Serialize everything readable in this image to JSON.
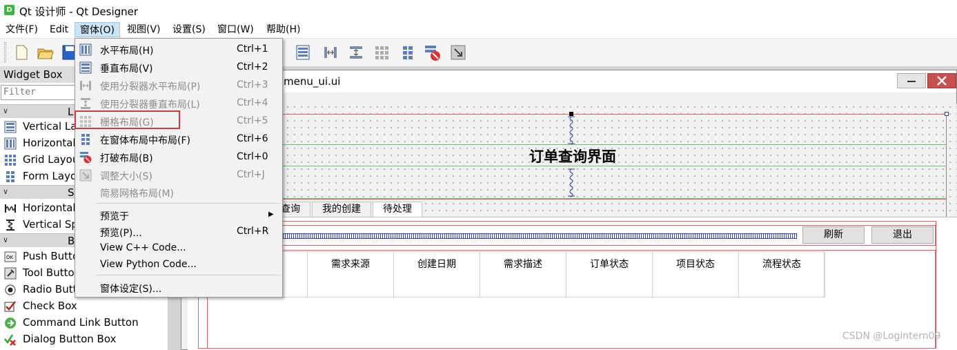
{
  "window": {
    "title": "Qt 设计师 - Qt Designer",
    "app_icon_letter": "D"
  },
  "menubar": [
    "文件(F)",
    "Edit",
    "窗体(O)",
    "视图(V)",
    "设置(S)",
    "窗口(W)",
    "帮助(H)"
  ],
  "widget_box": {
    "title": "Widget Box",
    "filter_placeholder": "Filter",
    "categories": [
      "L",
      "S",
      "B"
    ],
    "layouts": [
      "Vertical La",
      "Horizontal",
      "Grid Layou",
      "Form Layo"
    ],
    "spacers": [
      "Horizontal",
      "Vertical Sp"
    ],
    "buttons": [
      "Push Butto",
      "Tool Butto",
      "Radio Butt",
      "Check Box",
      "Command Link Button",
      "Dialog Button Box"
    ]
  },
  "form_window": {
    "title": "menu_ui.ui",
    "heading": "订单查询界面",
    "tabs": [
      "查询",
      "我的创建",
      "待处理"
    ],
    "refresh_button": "刷新",
    "exit_button": "退出",
    "table_headers": [
      "需求来源",
      "创建日期",
      "需求描述",
      "订单状态",
      "项目状态",
      "流程状态"
    ]
  },
  "form_menu": {
    "items": [
      {
        "label": "水平布局(H)",
        "shortcut": "Ctrl+1",
        "icon": "horizontal-layout-icon",
        "enabled": true
      },
      {
        "label": "垂直布局(V)",
        "shortcut": "Ctrl+2",
        "icon": "vertical-layout-icon",
        "enabled": true
      },
      {
        "label": "使用分裂器水平布局(P)",
        "shortcut": "Ctrl+3",
        "icon": "horizontal-splitter-icon",
        "enabled": false
      },
      {
        "label": "使用分裂器垂直布局(L)",
        "shortcut": "Ctrl+4",
        "icon": "vertical-splitter-icon",
        "enabled": false
      },
      {
        "label": "栅格布局(G)",
        "shortcut": "Ctrl+5",
        "icon": "grid-layout-icon",
        "enabled": false
      },
      {
        "label": "在窗体布局中布局(F)",
        "shortcut": "Ctrl+6",
        "icon": "form-layout-icon",
        "enabled": true
      },
      {
        "label": "打破布局(B)",
        "shortcut": "Ctrl+0",
        "icon": "break-layout-icon",
        "enabled": true
      },
      {
        "label": "调整大小(S)",
        "shortcut": "Ctrl+J",
        "icon": "adjust-size-icon",
        "enabled": false
      },
      {
        "label": "简易网格布局(M)",
        "shortcut": "",
        "icon": "",
        "enabled": false
      },
      {
        "label": "预览于",
        "shortcut": "",
        "icon": "",
        "enabled": true,
        "submenu": true
      },
      {
        "label": "预览(P)...",
        "shortcut": "Ctrl+R",
        "icon": "",
        "enabled": true
      },
      {
        "label": "View C++ Code...",
        "shortcut": "",
        "icon": "",
        "enabled": true
      },
      {
        "label": "View Python Code...",
        "shortcut": "",
        "icon": "",
        "enabled": true
      },
      {
        "label": "窗体设定(S)...",
        "shortcut": "",
        "icon": "",
        "enabled": true
      }
    ]
  },
  "watermark": "CSDN @Logintern09",
  "colors": {
    "highlight_border": "#d9373a",
    "selected_menu": "#cce4f7",
    "layout_red": "#e06060",
    "layout_green": "#6cc36c",
    "spacer_blue": "#3040b0"
  }
}
